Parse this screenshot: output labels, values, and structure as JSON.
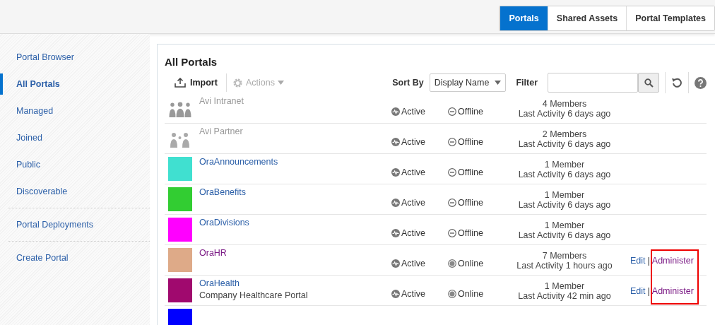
{
  "tabs": [
    {
      "label": "Portals",
      "selected": true
    },
    {
      "label": "Shared Assets",
      "selected": false
    },
    {
      "label": "Portal Templates",
      "selected": false
    }
  ],
  "sidebar": {
    "groups": [
      [
        {
          "label": "Portal Browser",
          "selected": false
        },
        {
          "label": "All Portals",
          "selected": true
        },
        {
          "label": "Managed",
          "selected": false
        },
        {
          "label": "Joined",
          "selected": false
        },
        {
          "label": "Public",
          "selected": false
        },
        {
          "label": "Discoverable",
          "selected": false
        }
      ],
      [
        {
          "label": "Portal Deployments",
          "selected": false
        }
      ],
      [
        {
          "label": "Create Portal",
          "selected": false
        }
      ]
    ]
  },
  "panel": {
    "title": "All Portals",
    "toolbar": {
      "import": "Import",
      "actions": {
        "label": "Actions",
        "disabled": true
      },
      "sort_label": "Sort By",
      "sort_value": "Display Name",
      "filter_label": "Filter"
    }
  },
  "portals": [
    {
      "kind": "group",
      "name": "Avi Intranet",
      "disabled": true,
      "visited": false,
      "status": "Active",
      "online": false,
      "availability": "Offline",
      "members": "4 Members",
      "activity": "Last Activity 6 days ago"
    },
    {
      "kind": "pair",
      "name": "Avi Partner",
      "disabled": true,
      "visited": false,
      "status": "Active",
      "online": false,
      "availability": "Offline",
      "members": "2 Members",
      "activity": "Last Activity 6 days ago"
    },
    {
      "kind": "swatch",
      "color": "#40e0d0",
      "name": "OraAnnouncements",
      "disabled": false,
      "visited": false,
      "status": "Active",
      "online": false,
      "availability": "Offline",
      "members": "1 Member",
      "activity": "Last Activity 6 days ago"
    },
    {
      "kind": "swatch",
      "color": "#32cd32",
      "name": "OraBenefits",
      "disabled": false,
      "visited": false,
      "status": "Active",
      "online": false,
      "availability": "Offline",
      "members": "1 Member",
      "activity": "Last Activity 6 days ago"
    },
    {
      "kind": "swatch",
      "color": "#ff00ff",
      "name": "OraDivisions",
      "disabled": false,
      "visited": false,
      "status": "Active",
      "online": false,
      "availability": "Offline",
      "members": "1 Member",
      "activity": "Last Activity 6 days ago"
    },
    {
      "kind": "swatch",
      "color": "#deaa88",
      "name": "OraHR",
      "disabled": false,
      "visited": true,
      "status": "Active",
      "online": true,
      "availability": "Online",
      "members": "7 Members",
      "activity": "Last Activity 1 hours ago",
      "actions": {
        "edit": "Edit",
        "separator": "|",
        "administer": "Administer"
      }
    },
    {
      "kind": "swatch",
      "color": "#a0096e",
      "name": "OraHealth",
      "description": "Company Healthcare Portal",
      "disabled": false,
      "visited": false,
      "status": "Active",
      "online": true,
      "availability": "Online",
      "members": "1 Member",
      "activity": "Last Activity 42 min ago",
      "actions": {
        "edit": "Edit",
        "separator": "|",
        "administer": "Administer"
      }
    },
    {
      "kind": "swatch",
      "color": "#0000ff"
    }
  ]
}
